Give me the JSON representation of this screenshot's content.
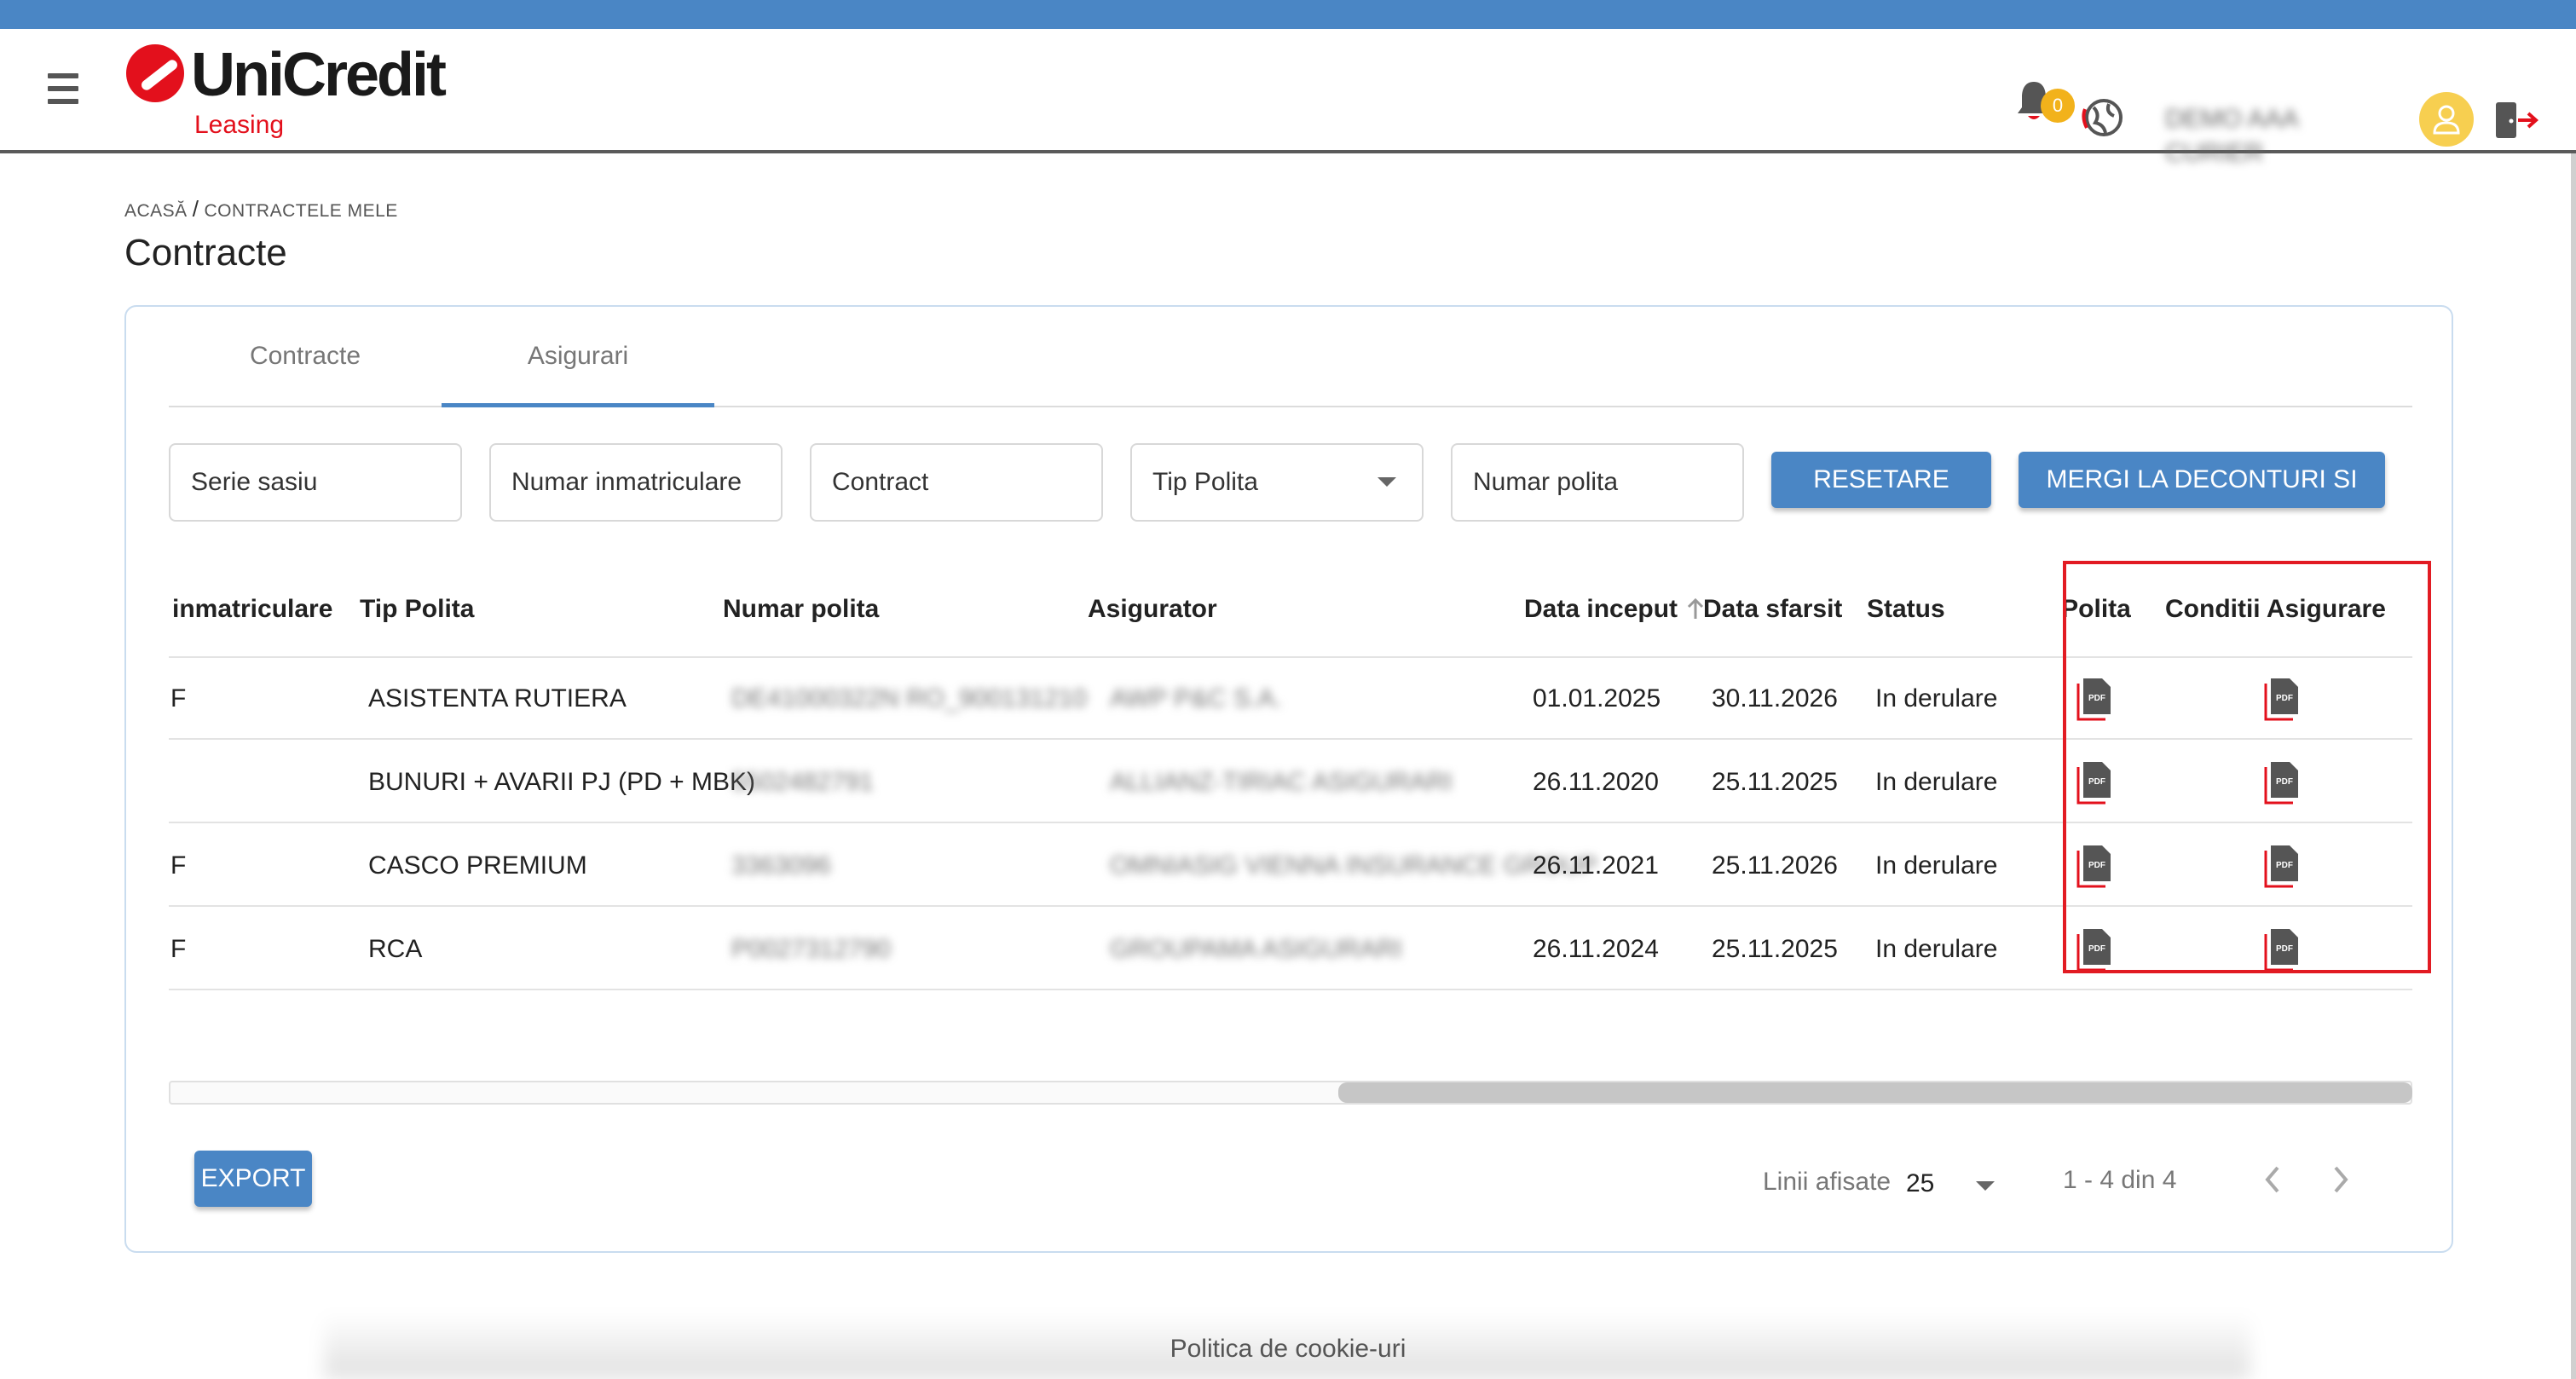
{
  "header": {
    "brand_name": "UniCredit",
    "brand_sub": "Leasing",
    "notification_count": "0",
    "user_name": "DEMO AAA CURIER"
  },
  "breadcrumb": {
    "home": "ACASĂ",
    "separator": "/",
    "current": "CONTRACTELE MELE"
  },
  "page_title": "Contracte",
  "tabs": [
    {
      "label": "Contracte",
      "active": false
    },
    {
      "label": "Asigurari",
      "active": true
    }
  ],
  "filters": {
    "serie_sasiu": "Serie sasiu",
    "numar_inmatriculare": "Numar inmatriculare",
    "contract": "Contract",
    "tip_polita": "Tip Polita",
    "numar_polita": "Numar polita"
  },
  "buttons": {
    "reset": "RESETARE FILTRU",
    "deconturi": "MERGI LA DECONTURI SI PLATI",
    "export": "EXPORT"
  },
  "table": {
    "headers": {
      "inmatriculare": "inmatriculare",
      "tip_polita": "Tip Polita",
      "numar_polita": "Numar polita",
      "asigurator": "Asigurator",
      "data_inceput": "Data inceput",
      "data_sfarsit": "Data sfarsit",
      "status": "Status",
      "polita": "Polita",
      "conditii": "Conditii Asigurare"
    },
    "rows": [
      {
        "inmatriculare": "F",
        "tip_polita": "ASISTENTA RUTIERA",
        "numar_polita": "DE41000322N RO_900131210",
        "asigurator": "AWP P&C S.A.",
        "data_inceput": "01.01.2025",
        "data_sfarsit": "30.11.2026",
        "status": "In derulare"
      },
      {
        "inmatriculare": "",
        "tip_polita": "BUNURI + AVARII PJ (PD + MBK)",
        "numar_polita": "5502482791",
        "asigurator": "ALLIANZ-TIRIAC ASIGURARI",
        "data_inceput": "26.11.2020",
        "data_sfarsit": "25.11.2025",
        "status": "In derulare"
      },
      {
        "inmatriculare": "F",
        "tip_polita": "CASCO PREMIUM",
        "numar_polita": "3363096",
        "asigurator": "OMNIASIG VIENNA INSURANCE GROUP",
        "data_inceput": "26.11.2021",
        "data_sfarsit": "25.11.2026",
        "status": "In derulare"
      },
      {
        "inmatriculare": "F",
        "tip_polita": "RCA",
        "numar_polita": "P0027312790",
        "asigurator": "GROUPAMA ASIGURARI",
        "data_inceput": "26.11.2024",
        "data_sfarsit": "25.11.2025",
        "status": "In derulare"
      }
    ]
  },
  "pagination": {
    "lines_label": "Linii afisate",
    "lines_value": "25",
    "range": "1 - 4 din 4"
  },
  "footer": {
    "cookie": "Politica de cookie-uri"
  },
  "colors": {
    "accent": "#4a86c5",
    "brand_red": "#e3101c",
    "highlight": "#e21b23",
    "badge": "#f2b21b"
  },
  "icons": [
    "menu-icon",
    "bell-icon",
    "globe-icon",
    "user-icon",
    "logout-icon",
    "pdf-icon",
    "sort-up-icon",
    "chevron-left-icon",
    "chevron-right-icon",
    "caret-down-icon"
  ]
}
